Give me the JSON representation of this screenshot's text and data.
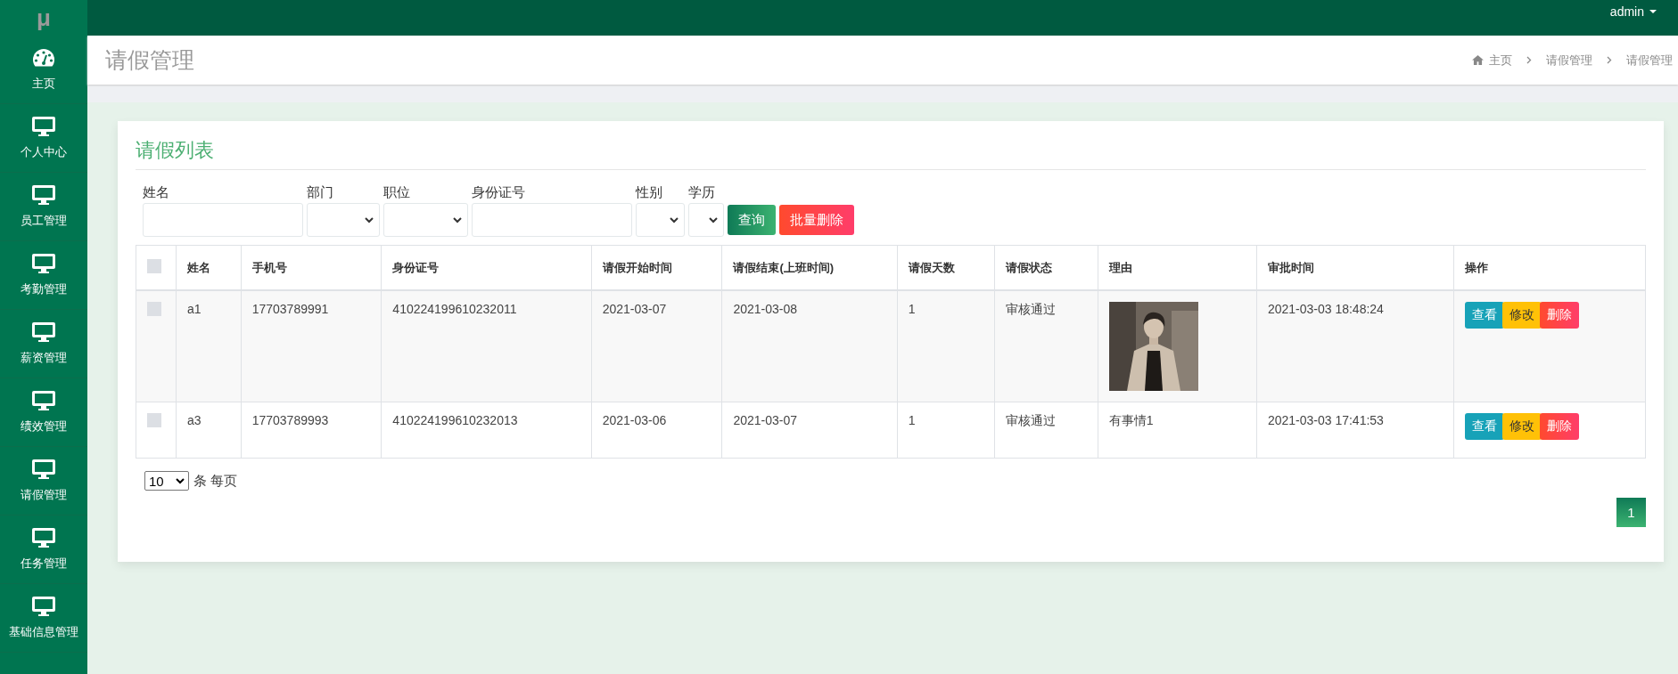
{
  "logo": "μ",
  "user_menu": {
    "label": "admin"
  },
  "sidebar": {
    "items": [
      {
        "label": "主页"
      },
      {
        "label": "个人中心"
      },
      {
        "label": "员工管理"
      },
      {
        "label": "考勤管理"
      },
      {
        "label": "薪资管理"
      },
      {
        "label": "绩效管理"
      },
      {
        "label": "请假管理"
      },
      {
        "label": "任务管理"
      },
      {
        "label": "基础信息管理"
      }
    ]
  },
  "page_title": "请假管理",
  "breadcrumb": [
    "主页",
    "请假管理",
    "请假管理"
  ],
  "card": {
    "title": "请假列表",
    "filters": [
      {
        "label": "姓名",
        "kind": "text"
      },
      {
        "label": "部门",
        "kind": "select"
      },
      {
        "label": "职位",
        "kind": "select"
      },
      {
        "label": "身份证号",
        "kind": "text"
      },
      {
        "label": "性别",
        "kind": "select"
      },
      {
        "label": "学历",
        "kind": "select"
      }
    ],
    "buttons": [
      {
        "label": "查询",
        "kind": "search"
      },
      {
        "label": "批量删除",
        "kind": "danger"
      }
    ],
    "table": {
      "header_checked": false,
      "columns": [
        "姓名",
        "手机号",
        "身份证号",
        "请假开始时间",
        "请假结束(上班时间)",
        "请假天数",
        "请假状态",
        "理由",
        "审批时间",
        "操作"
      ],
      "rows": [
        {
          "checked": false,
          "name": "a1",
          "phone": "17703789991",
          "id_number": "410224199610232011",
          "start": "2021-03-07",
          "end": "2021-03-08",
          "days": "1",
          "status": "审核通过",
          "approved_at": "2021-03-03 18:48:24",
          "actions": [
            {
              "label": "查看",
              "kind": "view"
            },
            {
              "label": "修改",
              "kind": "edit"
            },
            {
              "label": "删除",
              "kind": "delete"
            }
          ]
        },
        {
          "checked": false,
          "name": "a3",
          "phone": "17703789993",
          "id_number": "410224199610232013",
          "start": "2021-03-06",
          "end": "2021-03-07",
          "days": "1",
          "status": "审核通过",
          "reason": {
            "kind": "text",
            "text": "有事情1"
          },
          "approved_at": "2021-03-03 17:41:53",
          "actions": [
            {
              "label": "查看",
              "kind": "view"
            },
            {
              "label": "修改",
              "kind": "edit"
            },
            {
              "label": "删除",
              "kind": "delete"
            }
          ]
        }
      ]
    },
    "page_size": {
      "value": "10",
      "label": "条 每页"
    },
    "pages": [
      {
        "label": "1",
        "selected": true
      }
    ]
  }
}
